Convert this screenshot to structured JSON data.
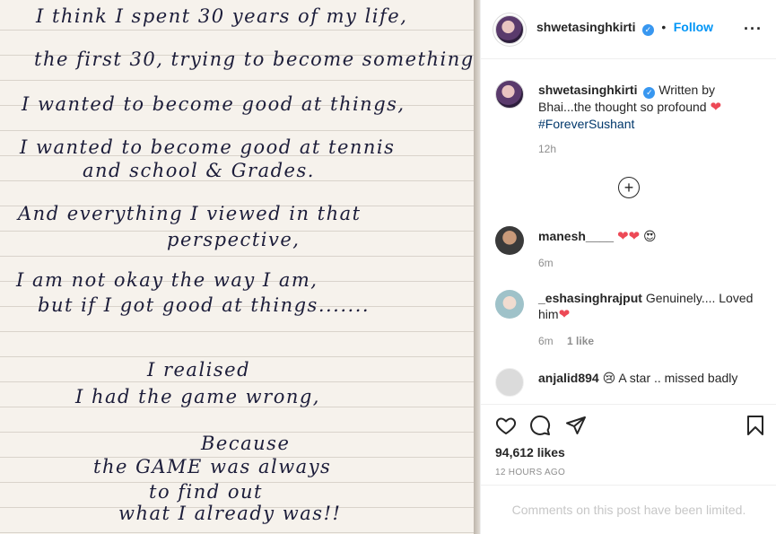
{
  "note": {
    "lines": [
      "I think I spent 30 years of my life,",
      "the first 30, trying to become something.",
      "I wanted to become good at things,",
      "I wanted to become good at tennis",
      "and school & Grades.",
      "And everything I viewed in that",
      "perspective,",
      "I am not okay the way I am,",
      "but if I got good at things.......",
      "I realised",
      "I had the game wrong,",
      "Because",
      "the GAME was always",
      "to find out",
      "what I already was!!"
    ]
  },
  "header": {
    "username": "shwetasinghkirti",
    "separator": "•",
    "follow_label": "Follow"
  },
  "caption": {
    "username": "shwetasinghkirti",
    "text_before": "Written by Bhai...the thought so profound",
    "hashtag": "#ForeverSushant",
    "time": "12h"
  },
  "load_more": {
    "icon": "plus-circle-icon"
  },
  "comments": [
    {
      "username": "manesh____",
      "text": "",
      "emojis": "❤❤",
      "face": "😍",
      "time": "6m",
      "likes": ""
    },
    {
      "username": "_eshasinghrajput",
      "text": "Genuinely.... Loved him",
      "emojis": "❤",
      "face": "",
      "time": "6m",
      "likes": "1 like"
    },
    {
      "username": "anjalid894",
      "text": "A star .. missed badly",
      "emojis": "",
      "face": "😢",
      "time": "",
      "likes": ""
    }
  ],
  "actions": {
    "like_icon": "heart-outline-icon",
    "comment_icon": "comment-bubble-icon",
    "share_icon": "paper-plane-icon",
    "save_icon": "bookmark-icon"
  },
  "likes_count": "94,612 likes",
  "time_ago": "12 HOURS AGO",
  "comments_limited": "Comments on this post have been limited.",
  "colors": {
    "accent": "#0095f6",
    "verified": "#3897f0",
    "heart": "#ed4956",
    "ink": "#1c1d3a"
  }
}
